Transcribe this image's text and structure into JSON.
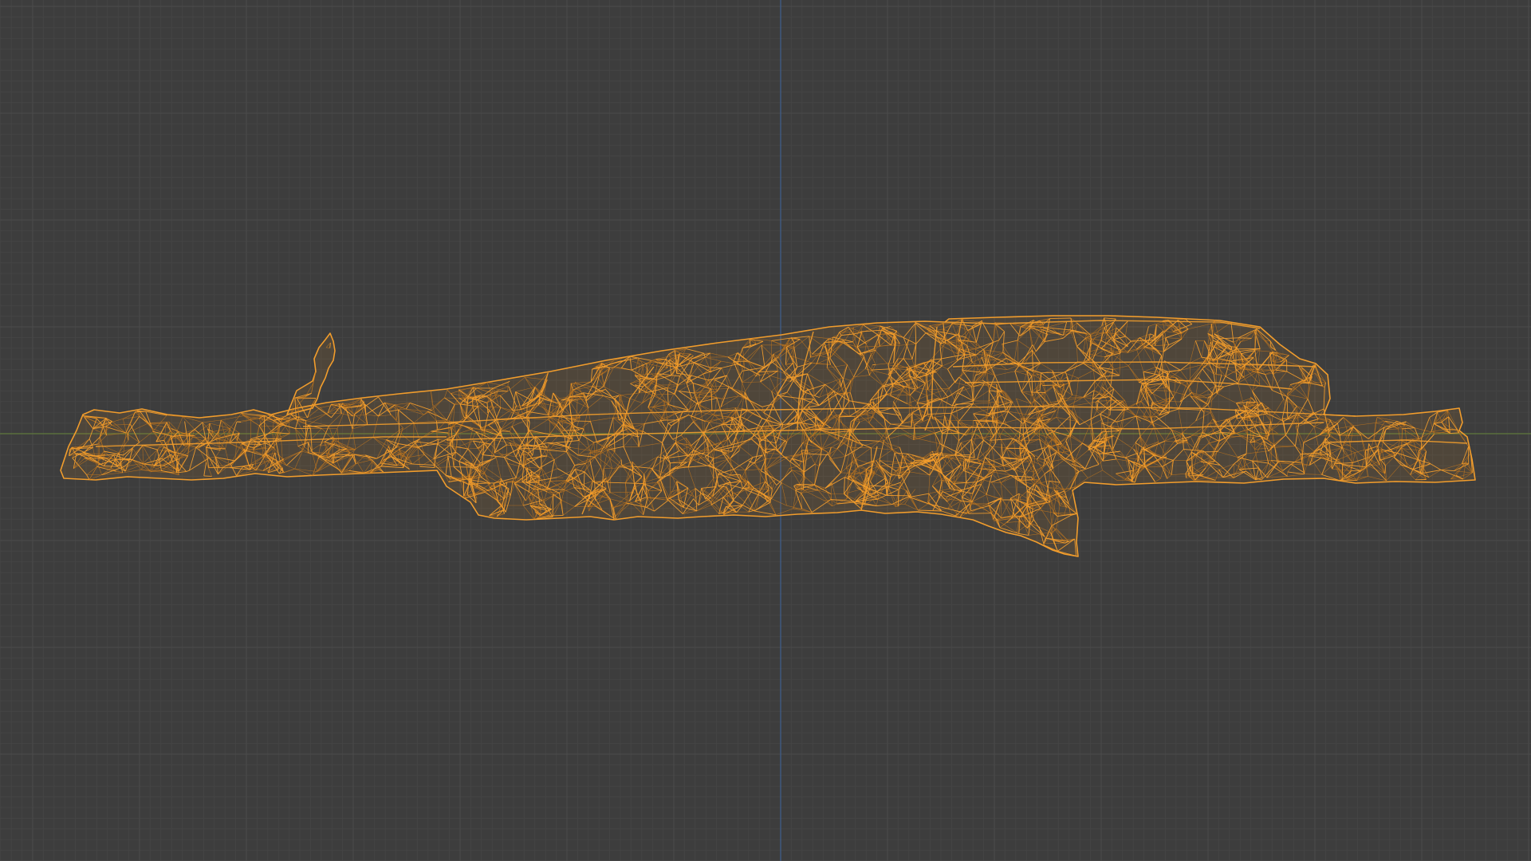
{
  "viewport": {
    "view": "orthographic-front",
    "background_color": "#3d3d3d",
    "grid_minor_color": "#444444",
    "grid_major_color": "#4b4b4b",
    "axis_x_color": "#5f7a3c",
    "axis_z_color": "#3f5f8f",
    "selection_wire_color": "#f29d2c",
    "selection_wire_dim_color": "#c87a1c"
  },
  "object": {
    "name_icon": "mesh-wireframe-icon",
    "state": "selected",
    "display": "wireframe"
  }
}
